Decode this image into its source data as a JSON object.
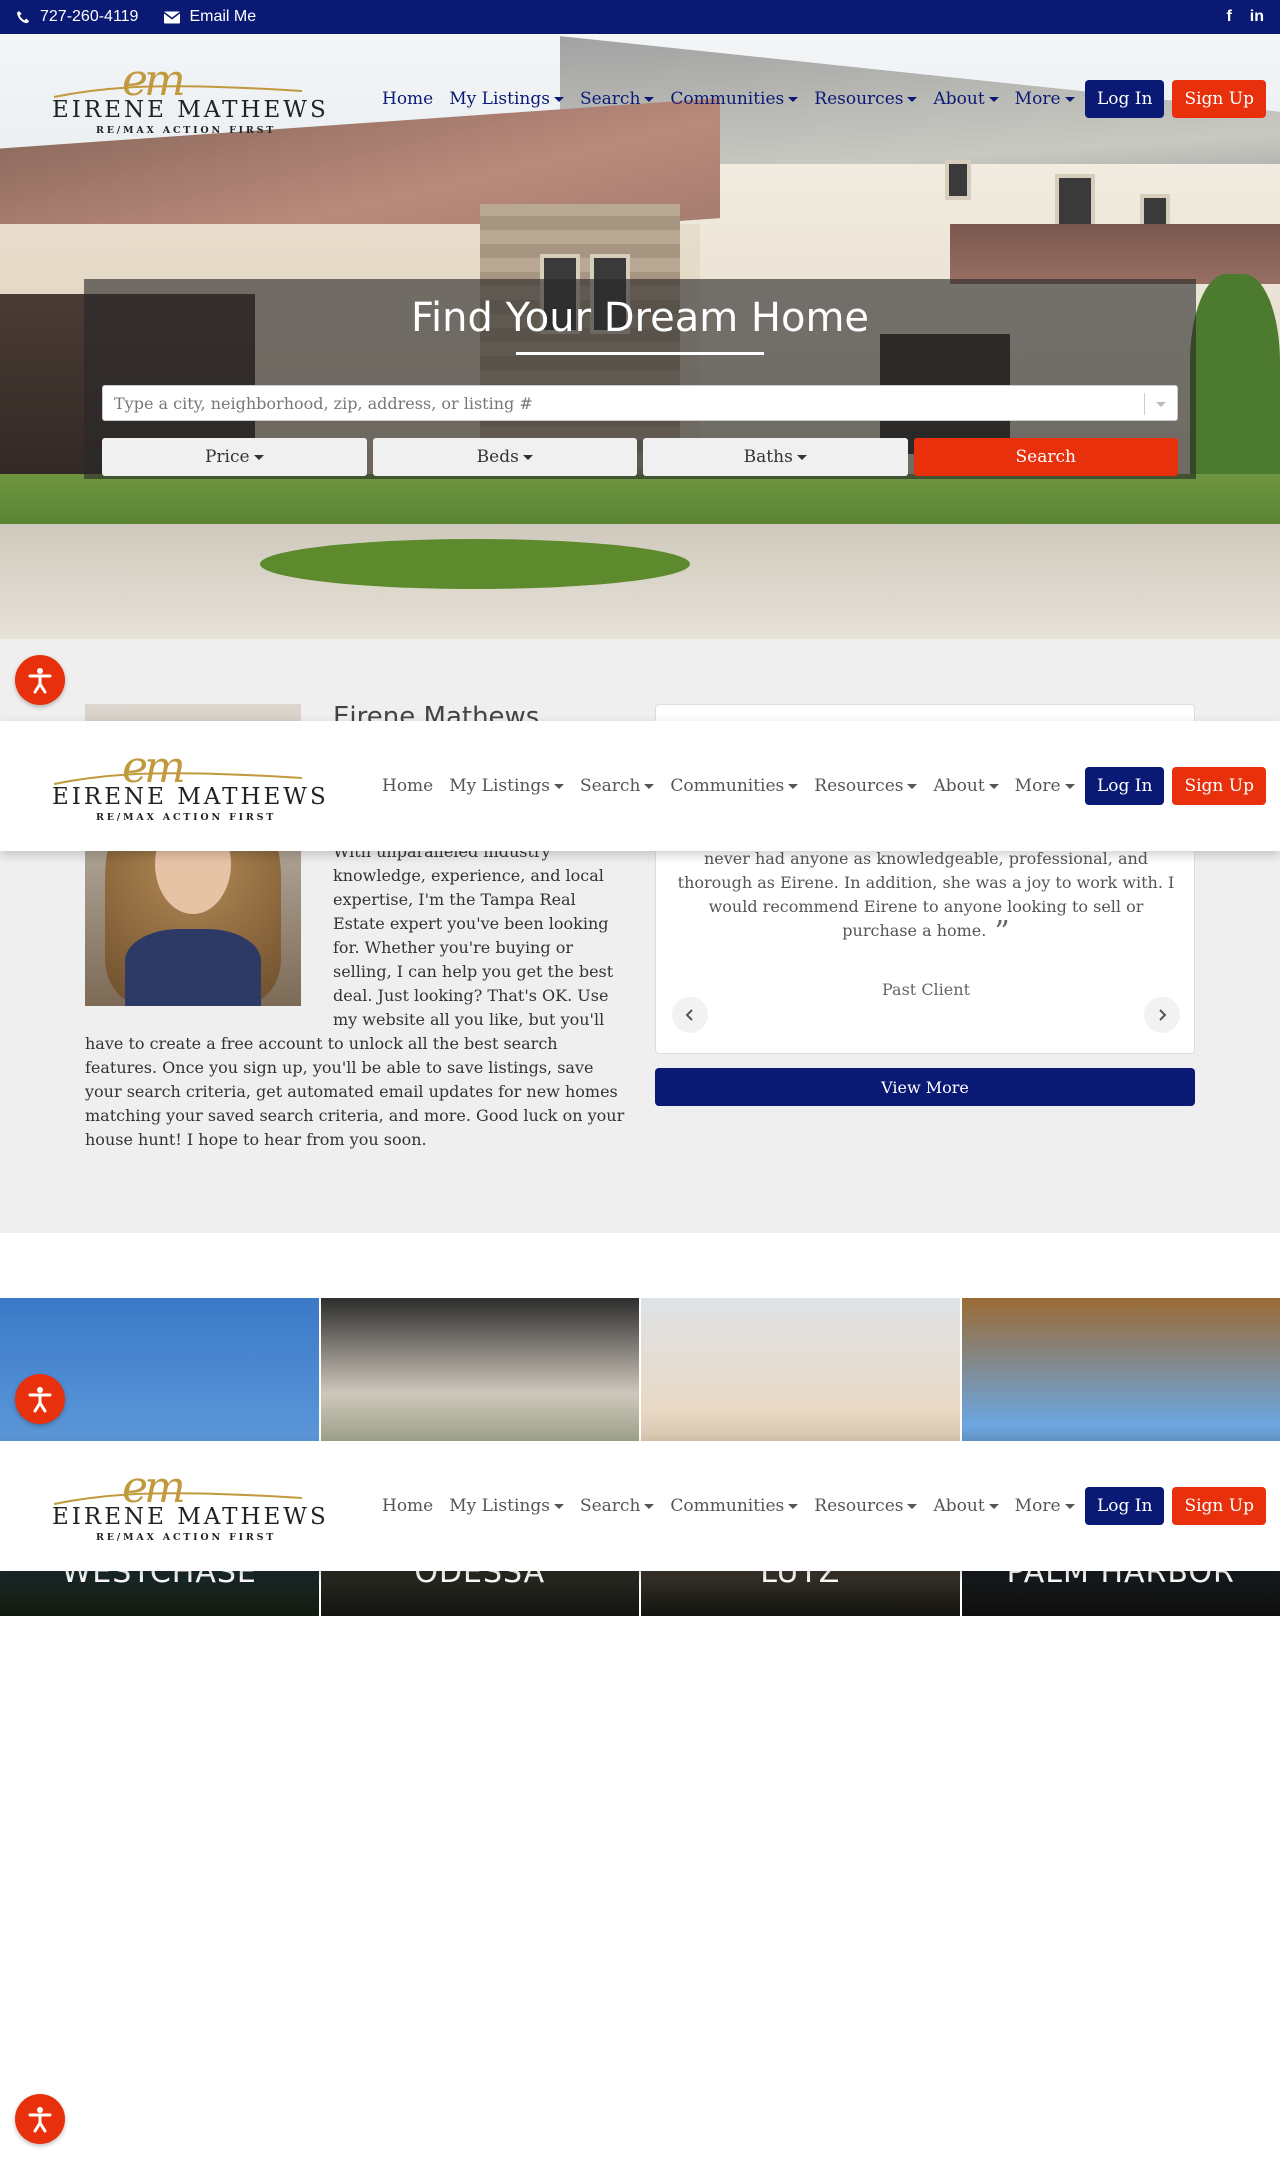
{
  "topbar": {
    "phone": "727-260-4119",
    "email_label": "Email Me",
    "social": [
      "f",
      "in"
    ]
  },
  "logo": {
    "script": "em",
    "name": "EIRENE MATHEWS",
    "sub": "RE/MAX ACTION FIRST"
  },
  "nav": {
    "items": [
      {
        "label": "Home",
        "dropdown": false
      },
      {
        "label": "My Listings",
        "dropdown": true
      },
      {
        "label": "Search",
        "dropdown": true
      },
      {
        "label": "Communities",
        "dropdown": true
      },
      {
        "label": "Resources",
        "dropdown": true
      },
      {
        "label": "About",
        "dropdown": true
      },
      {
        "label": "More",
        "dropdown": true
      }
    ],
    "login": "Log In",
    "signup": "Sign Up"
  },
  "hero": {
    "title": "Find Your Dream Home",
    "search_placeholder": "Type a city, neighborhood, zip, address, or listing #",
    "filters": [
      "Price",
      "Beds",
      "Baths"
    ],
    "search_button": "Search"
  },
  "about": {
    "name": "Eirene Mathews",
    "bio": "With unparalleled industry knowledge, experience, and local expertise, I'm the Tampa Real Estate expert you've been looking for. Whether you're buying or selling, I can help you get the best deal. Just looking? That's OK. Use my website all you like, but you'll have to create a free account to unlock all the best search features. Once you sign up, you'll be able to save listings, save your search criteria, get automated email updates for new homes matching your saved search criteria, and more. Good luck on your house hunt! I hope to hear from you soon."
  },
  "testimonial": {
    "quote": "never had anyone as knowledgeable, professional, and thorough as Eirene. In addition, she was a joy to work with. I would recommend Eirene to anyone looking to sell or purchase a home.",
    "author": "Past Client",
    "view_more": "View More"
  },
  "communities": [
    "Westchase",
    "Odessa",
    "Lutz",
    "Palm Harbor"
  ],
  "colors": {
    "brand_navy": "#0a1a74",
    "accent_red": "#e8300c",
    "logo_gold": "#c19a3f"
  }
}
